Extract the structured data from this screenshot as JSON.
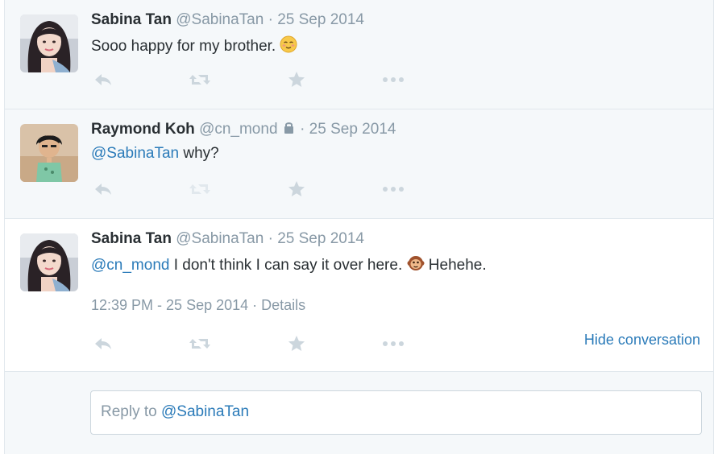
{
  "tweets": [
    {
      "name": "Sabina Tan",
      "handle": "@SabinaTan",
      "date": "· 25 Sep 2014",
      "text": "Sooo happy for my brother.",
      "emoji": "relieved-face"
    },
    {
      "name": "Raymond Koh",
      "handle": "@cn_mond",
      "date": "· 25 Sep 2014",
      "mention": "@SabinaTan",
      "text": " why?",
      "protected": true
    },
    {
      "name": "Sabina Tan",
      "handle": "@SabinaTan",
      "date": "· 25 Sep 2014",
      "mention": "@cn_mond",
      "text_before": " I don't think I can say it over here.",
      "text_after": " Hehehe.",
      "emoji": "monkey-face",
      "timestamp": "12:39 PM - 25 Sep 2014",
      "details_label": "· Details",
      "hide_label": "Hide conversation"
    }
  ],
  "reply": {
    "prefix": "Reply to ",
    "mention": "@SabinaTan"
  },
  "colors": {
    "link": "#2b7bb9",
    "muted": "#8899a6",
    "icon": "#ccd6dd"
  }
}
